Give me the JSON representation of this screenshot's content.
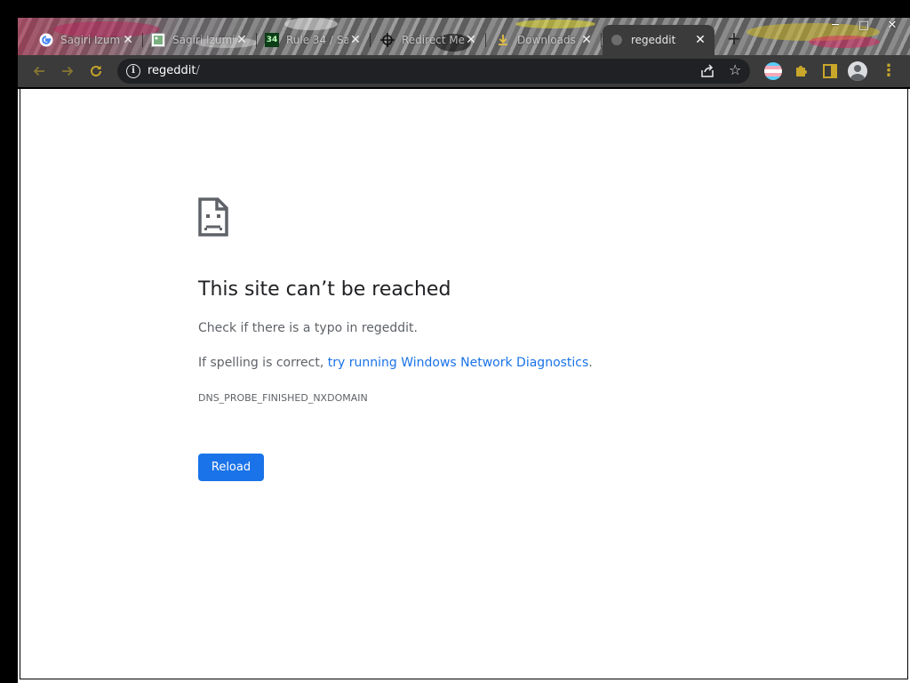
{
  "tabs": [
    {
      "title": "Sagiri Izumi",
      "favicon": "google-icon",
      "active": false
    },
    {
      "title": "Sagiri Izumi",
      "favicon": "image-icon",
      "active": false
    },
    {
      "title": "Rule 34 / Sa",
      "favicon": "rule34-icon",
      "favicon_text": "34",
      "active": false
    },
    {
      "title": "Redirect Me",
      "favicon": "crosshair-icon",
      "active": false
    },
    {
      "title": "Downloads",
      "favicon": "download-icon",
      "active": false
    },
    {
      "title": "regeddit",
      "favicon": "globe-icon",
      "active": true
    }
  ],
  "window_controls": {
    "minimize": "─",
    "maximize": "□",
    "close": "✕"
  },
  "toolbar": {
    "url_host": "regeddit",
    "url_path": "/",
    "accent_color": "#c8a72a"
  },
  "error_page": {
    "heading": "This site can’t be reached",
    "check_text": "Check if there is a typo in regeddit.",
    "spelling_prefix": "If spelling is correct, ",
    "diagnostics_link": "try running Windows Network Diagnostics",
    "spelling_suffix": ".",
    "error_code": "DNS_PROBE_FINISHED_NXDOMAIN",
    "reload_label": "Reload",
    "button_color": "#1a73e8"
  }
}
